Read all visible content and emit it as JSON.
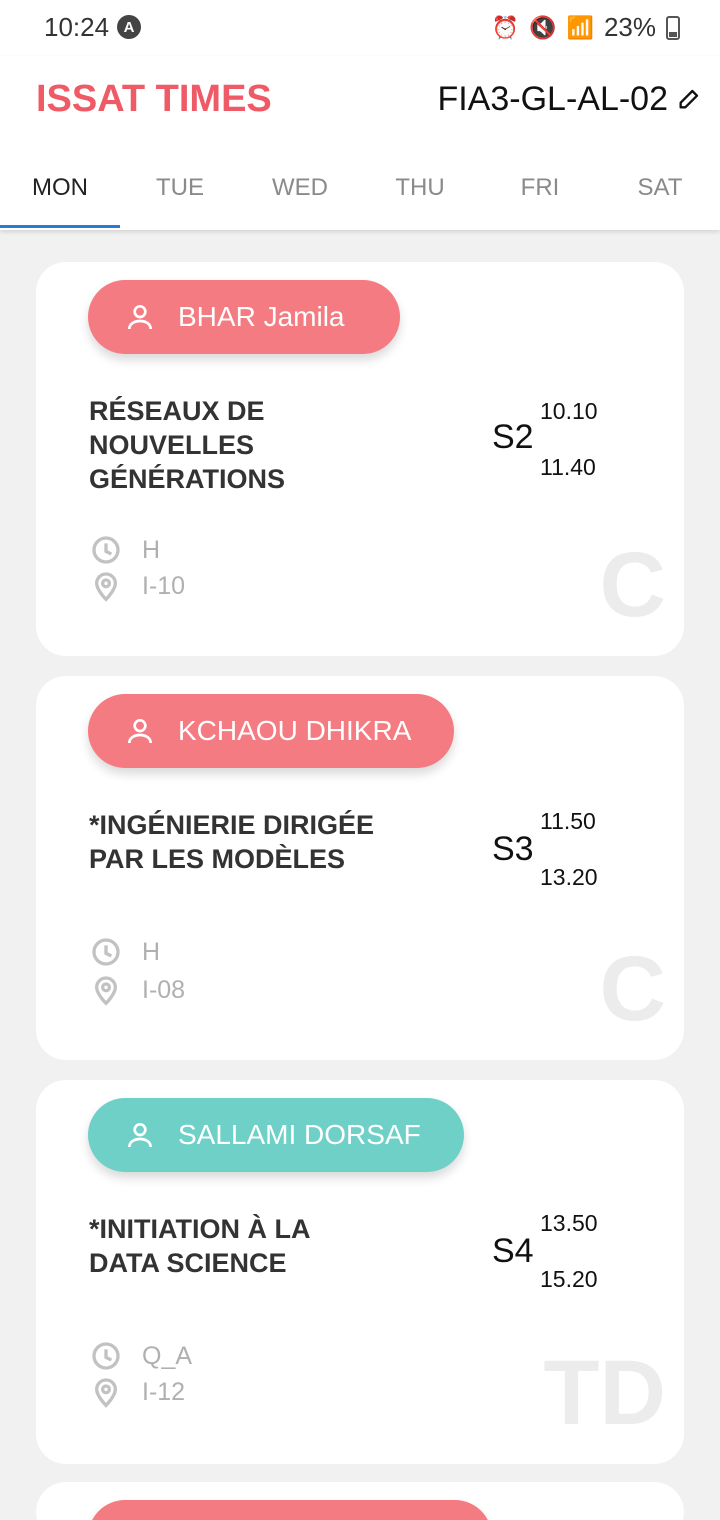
{
  "status_bar": {
    "time": "10:24",
    "app_badge": "A",
    "battery": "23%"
  },
  "header": {
    "title": "ISSAT TIMES",
    "group": "FIA3-GL-AL-02"
  },
  "tabs": [
    "MON",
    "TUE",
    "WED",
    "THU",
    "FRI",
    "SAT"
  ],
  "active_tab": "MON",
  "colors": {
    "brand": "#ee5a66",
    "course_pill": "#f57b82",
    "td_pill": "#6fd0c8",
    "tab_indicator": "#2b7bd3"
  },
  "sessions": [
    {
      "teacher": "BHAR Jamila",
      "course": "RÉSEAUX DE NOUVELLES GÉNÉRATIONS",
      "session": "S2",
      "start": "10.10",
      "end": "11.40",
      "mode": "H",
      "room": "I-10",
      "type": "C"
    },
    {
      "teacher": "KCHAOU DHIKRA",
      "course": "*INGÉNIERIE DIRIGÉE PAR LES MODÈLES",
      "session": "S3",
      "start": "11.50",
      "end": "13.20",
      "mode": "H",
      "room": "I-08",
      "type": "C"
    },
    {
      "teacher": "SALLAMI DORSAF",
      "course": "*INITIATION À LA DATA SCIENCE",
      "session": "S4",
      "start": "13.50",
      "end": "15.20",
      "mode": "Q_A",
      "room": "I-12",
      "type": "TD"
    }
  ]
}
